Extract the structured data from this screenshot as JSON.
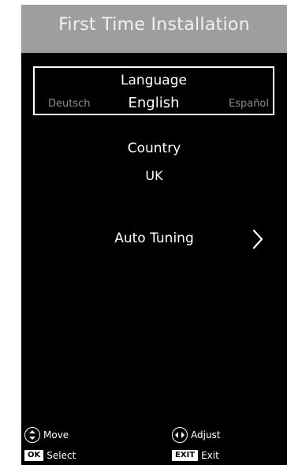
{
  "header": {
    "title": "First Time Installation"
  },
  "language": {
    "heading": "Language",
    "prev": "Deutsch",
    "current": "English",
    "next": "Español"
  },
  "country": {
    "heading": "Country",
    "value": "UK"
  },
  "auto_tuning": {
    "label": "Auto Tuning",
    "icon": "chevron-right-icon"
  },
  "footer": {
    "move_label": "Move",
    "adjust_label": "Adjust",
    "ok_key": "OK",
    "select_label": "Select",
    "exit_key": "EXIT",
    "exit_label": "Exit"
  },
  "colors": {
    "background": "#000000",
    "title_bar": "#9e9e9e",
    "text": "#ffffff",
    "inactive_text": "#8a8a8a"
  }
}
